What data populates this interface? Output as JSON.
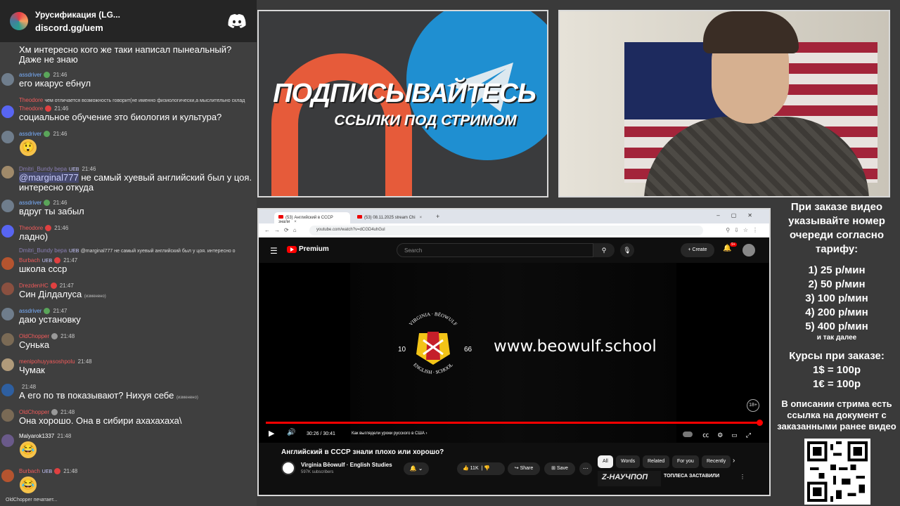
{
  "chat": {
    "server_name": "Урусификация (LG...",
    "server_link": "discord.gg/uem",
    "typing": "OldChopper печатает...",
    "messages": [
      {
        "text": "Хм интересно кого же таки написал пынеальный? Даже не знаю"
      },
      {
        "user": "assdriver",
        "time": "21:46",
        "text": "его икарус ебнул"
      },
      {
        "user": "Theodore",
        "small": "чем отличается возможность говорит(не именно физиологически,а мыслительно склад"
      },
      {
        "user": "Theodore",
        "time": "21:46",
        "text": "социальное обучение это биология и культура?"
      },
      {
        "user": "assdriver",
        "time": "21:46",
        "emoji": "😲"
      },
      {
        "user": "Dmitri_Bundy bepa",
        "tag": "UEB",
        "time": "21:46",
        "mention": "@marginal777",
        "text": " не самый хуевый английский был у цоя. интересно откуда"
      },
      {
        "user": "assdriver",
        "time": "21:46",
        "text": "вдруг ты забыл"
      },
      {
        "user": "Theodore",
        "time": "21:46",
        "text": "ладно)"
      },
      {
        "user": "Dmitri_Bundy bepa",
        "tag": "UEB",
        "small": "@marginal777 не самый хуевый английский был у цоя. интересно о"
      },
      {
        "user": "Burbach",
        "tag": "UEB",
        "time": "21:47",
        "text": "школа ссср"
      },
      {
        "user": "DrezdenHC",
        "time": "21:47",
        "text": "Син Ділдалуса",
        "edited": "(изменено)"
      },
      {
        "user": "assdriver",
        "time": "21:47",
        "text": "даю установку"
      },
      {
        "user": "OldChopper",
        "time": "21:48",
        "text": "Сунька"
      },
      {
        "user": "menipohuyyasoshpolu",
        "time": "21:48",
        "text": "Чумак"
      },
      {
        "user": "",
        "time": "21:48",
        "text": "А его по тв показывают? Нихуя себе",
        "edited": "(изменено)"
      },
      {
        "user": "OldChopper",
        "time": "21:48",
        "text": "Она хорошо. Она в сибири ахахахаха\\"
      },
      {
        "user": "Malyarok1337",
        "time": "21:48",
        "emoji": "😂"
      },
      {
        "user": "Burbach",
        "tag": "UEB",
        "time": "21:48",
        "emoji": "😂"
      }
    ]
  },
  "promo": {
    "title": "ПОДПИСЫВАЙТЕСЬ",
    "subtitle": "ССЫЛКИ ПОД СТРИМОМ"
  },
  "info": {
    "head": "При заказе видео указывайте номер очереди согласно тарифу:",
    "tariffs": [
      "1) 25 р/мин",
      "2) 50 р/мин",
      "3) 100 р/мин",
      "4) 200 р/мин",
      "5) 400 р/мин"
    ],
    "tariffs_note": "и так далее",
    "courses_head": "Курсы при заказе:",
    "courses": [
      "1$ = 100р",
      "1€ = 100р"
    ],
    "desc": "В описании стрима есть ссылка на документ с заказанными ранее видео"
  },
  "browser": {
    "tabs": [
      {
        "label": "(53) Английский в СССР знали"
      },
      {
        "label": "(53) 08.11.2025 stream Chi"
      }
    ],
    "url": "youtube.com/watch?v=dCGD4uhGul",
    "yt": {
      "logo": "Premium",
      "search_placeholder": "Search",
      "create": "Create",
      "notif_count": "9+"
    },
    "video": {
      "overlay_url": "www.beowulf.school",
      "year_left": "10",
      "year_right": "66",
      "emblem_top": "VIRGINIA · BĒOWULF",
      "emblem_bottom": "ENGLISH · SCHOOL",
      "age": "18+",
      "progress": 0.994,
      "time": "30:26 / 30:41",
      "chapter": "Как выглядели уроки русского в США"
    },
    "title": "Английский в СССР знали плохо или хорошо?",
    "channel": "Virginia Bēowulf · English Studies",
    "subscribers": "597K subscribers",
    "likes": "11K",
    "share": "Share",
    "save": "Save",
    "chips": [
      "All",
      "Words",
      "Related",
      "For you",
      "Recently"
    ],
    "rec_thumb": "Z-НАУЧПОП",
    "rec_title": "ТОПЛЕСА ЗАСТАВИЛИ"
  },
  "colors": {
    "discord_blurple": "#5865f2",
    "yt_red": "#ff0000",
    "telegram_blue": "#1f8fd1",
    "dzen_orange": "#e65b3a"
  }
}
